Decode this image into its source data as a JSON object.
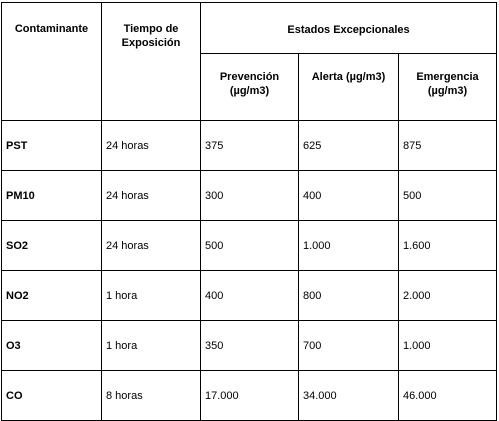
{
  "table": {
    "headers": {
      "contaminante": "Contaminante",
      "tiempo": "Tiempo de Exposición",
      "estados": "Estados Excepcionales",
      "prevencion": "Prevención (µg/m3)",
      "alerta": "Alerta (µg/m3)",
      "emergencia": "Emergencia (µg/m3)"
    },
    "rows": [
      {
        "contaminante": "PST",
        "tiempo": "24 horas",
        "prevencion": "375",
        "alerta": "625",
        "emergencia": "875"
      },
      {
        "contaminante": "PM10",
        "tiempo": "24 horas",
        "prevencion": "300",
        "alerta": "400",
        "emergencia": "500"
      },
      {
        "contaminante": "SO2",
        "tiempo": "24 horas",
        "prevencion": "500",
        "alerta": "1.000",
        "emergencia": "1.600"
      },
      {
        "contaminante": "NO2",
        "tiempo": "1 hora",
        "prevencion": "400",
        "alerta": "800",
        "emergencia": "2.000"
      },
      {
        "contaminante": "O3",
        "tiempo": "1 hora",
        "prevencion": "350",
        "alerta": "700",
        "emergencia": "1.000"
      },
      {
        "contaminante": "CO",
        "tiempo": "8 horas",
        "prevencion": "17.000",
        "alerta": "34.000",
        "emergencia": "46.000"
      }
    ]
  }
}
